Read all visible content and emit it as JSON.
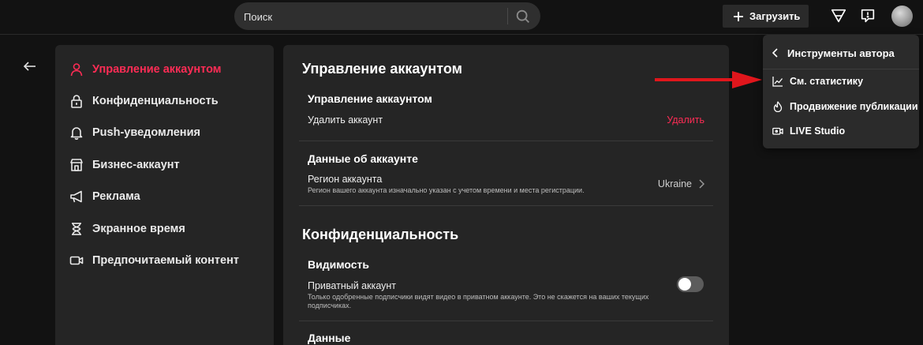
{
  "search": {
    "placeholder": "Поиск"
  },
  "topbar": {
    "upload_label": "Загрузить"
  },
  "sidebar": {
    "items": [
      {
        "label": "Управление аккаунтом"
      },
      {
        "label": "Конфиденциальность"
      },
      {
        "label": "Push-уведомления"
      },
      {
        "label": "Бизнес-аккаунт"
      },
      {
        "label": "Реклама"
      },
      {
        "label": "Экранное время"
      },
      {
        "label": "Предпочитаемый контент"
      }
    ]
  },
  "main": {
    "account_section_title": "Управление аккаунтом",
    "account_subtitle": "Управление аккаунтом",
    "delete_account_label": "Удалить аккаунт",
    "delete_action": "Удалить",
    "account_data_title": "Данные об аккаунте",
    "region_label": "Регион аккаунта",
    "region_hint": "Регион вашего аккаунта изначально указан с учетом времени и места регистрации.",
    "region_value": "Ukraine",
    "privacy_section_title": "Конфиденциальность",
    "visibility_title": "Видимость",
    "private_account_label": "Приватный аккаунт",
    "private_account_hint_1": "Только одобренные подписчики видят видео в приватном аккаунте. Это не скажется на ваших текущих",
    "private_account_hint_2": "подписчиках.",
    "private_account_enabled": false,
    "data_title": "Данные"
  },
  "dropdown": {
    "header": "Инструменты автора",
    "items": [
      {
        "label": "См. статистику",
        "icon": "chart-icon"
      },
      {
        "label": "Продвижение публикации",
        "icon": "flame-icon"
      },
      {
        "label": "LIVE Studio",
        "icon": "live-camera-icon"
      }
    ]
  },
  "colors": {
    "accent": "#fe2c55",
    "panel": "#252525",
    "background": "#121212",
    "annotation_arrow": "#e0161c"
  }
}
